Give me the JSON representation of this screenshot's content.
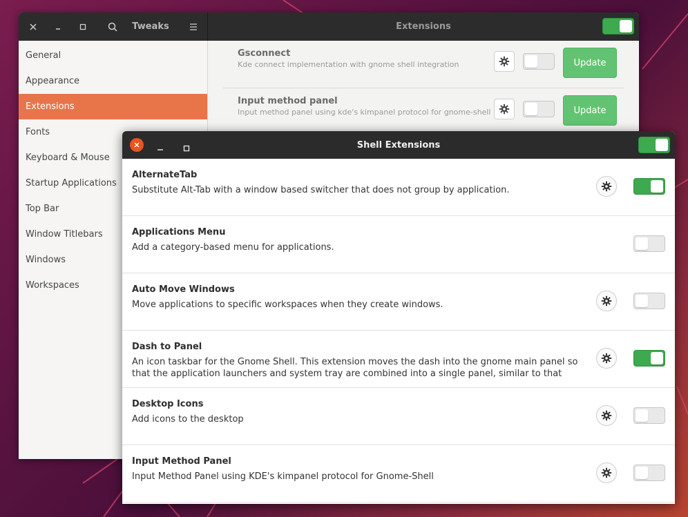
{
  "tweaks_window": {
    "title": "Tweaks",
    "panel_title": "Extensions",
    "master_switch_on": true,
    "sidebar": {
      "items": [
        {
          "label": "General",
          "active": false
        },
        {
          "label": "Appearance",
          "active": false
        },
        {
          "label": "Extensions",
          "active": true
        },
        {
          "label": "Fonts",
          "active": false
        },
        {
          "label": "Keyboard & Mouse",
          "active": false
        },
        {
          "label": "Startup Applications",
          "active": false
        },
        {
          "label": "Top Bar",
          "active": false
        },
        {
          "label": "Window Titlebars",
          "active": false
        },
        {
          "label": "Windows",
          "active": false
        },
        {
          "label": "Workspaces",
          "active": false
        }
      ]
    },
    "extensions": [
      {
        "name": "Gsconnect",
        "description": "Kde connect implementation with gnome shell integration",
        "enabled": false,
        "update_label": "Update"
      },
      {
        "name": "Input method panel",
        "description": "Input method panel using kde's kimpanel protocol for gnome-shell",
        "enabled": false,
        "update_label": "Update"
      }
    ]
  },
  "shell_window": {
    "title": "Shell Extensions",
    "master_switch_on": true,
    "extensions": [
      {
        "name": "AlternateTab",
        "description": "Substitute Alt-Tab with a window based switcher that does not group by application.",
        "has_settings": true,
        "enabled": true
      },
      {
        "name": "Applications Menu",
        "description": "Add a category-based menu for applications.",
        "has_settings": false,
        "enabled": false
      },
      {
        "name": "Auto Move Windows",
        "description": "Move applications to specific workspaces when they create windows.",
        "has_settings": true,
        "enabled": false
      },
      {
        "name": "Dash to Panel",
        "description": "An icon taskbar for the Gnome Shell. This extension moves the dash into the gnome main panel so that the application launchers and system tray are combined into a single panel, similar to that found in KDE Plasm…",
        "has_settings": true,
        "enabled": true
      },
      {
        "name": "Desktop Icons",
        "description": "Add icons to the desktop",
        "has_settings": true,
        "enabled": false
      },
      {
        "name": "Input Method Panel",
        "description": "Input Method Panel using KDE's kimpanel protocol for Gnome-Shell",
        "has_settings": true,
        "enabled": false
      }
    ]
  },
  "icons": {
    "close": "close-icon",
    "minimize": "minimize-icon",
    "maximize": "maximize-icon",
    "search": "search-icon",
    "menu": "menu-icon",
    "gear": "gear-icon"
  },
  "colors": {
    "accent_orange": "#e8754a",
    "switch_on": "#3daa4f",
    "update_green": "#62c472",
    "close_orange": "#e95420"
  }
}
